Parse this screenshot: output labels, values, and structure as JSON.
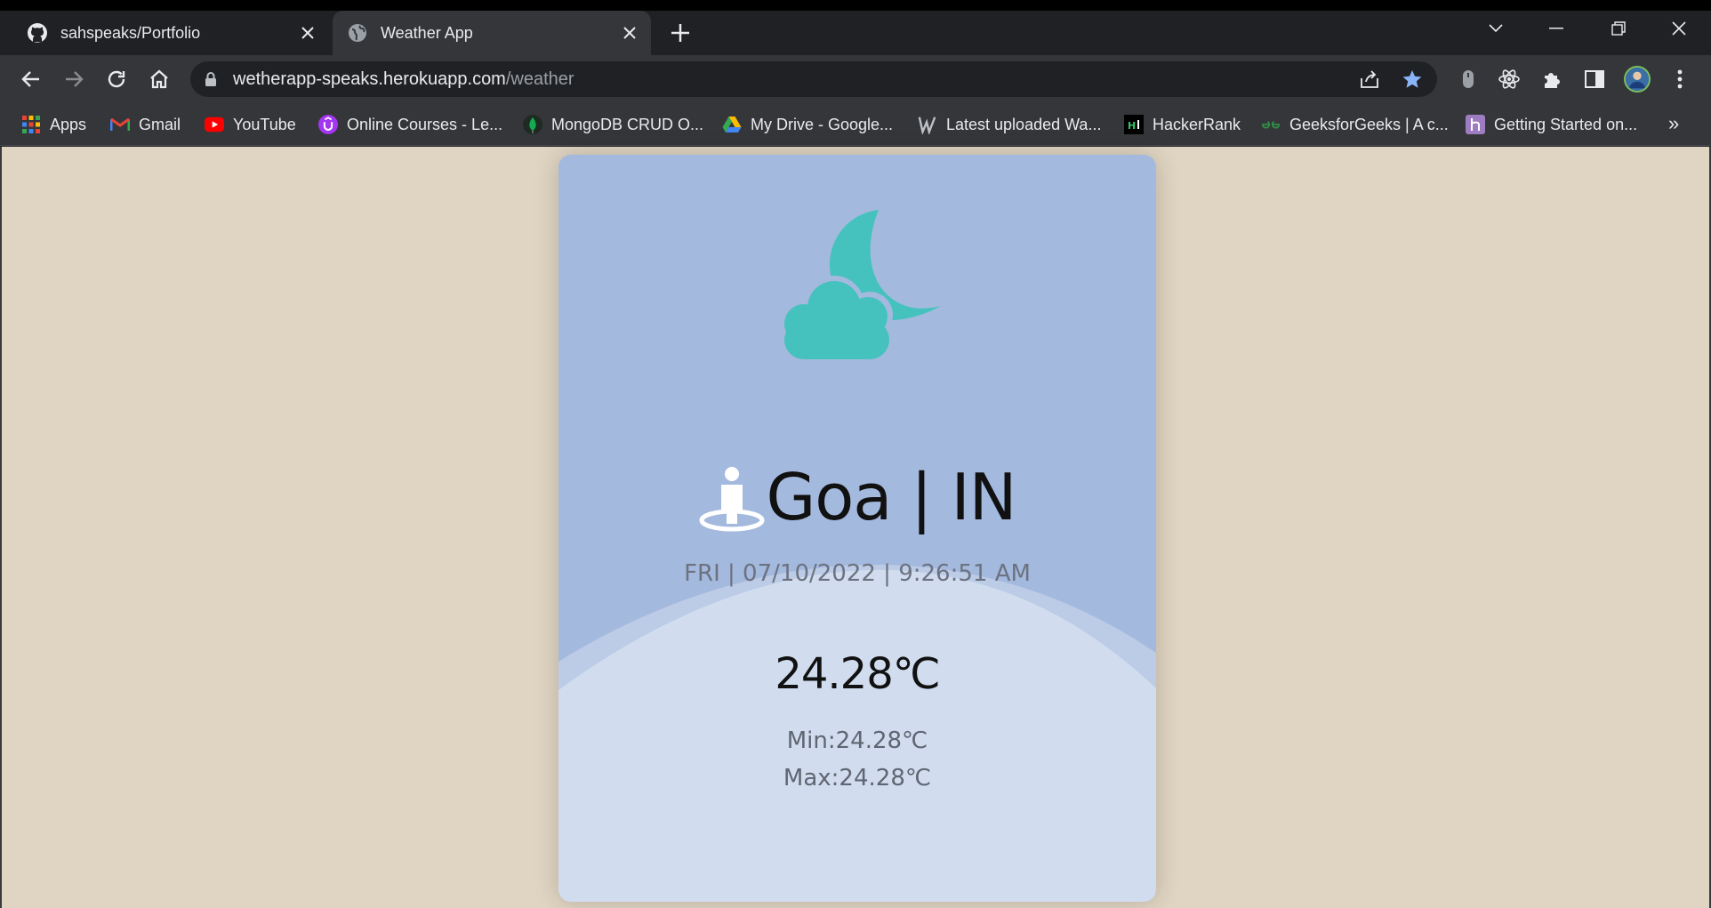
{
  "browser": {
    "tabs": [
      {
        "title": "sahspeaks/Portfolio",
        "favicon": "github-icon",
        "active": false
      },
      {
        "title": "Weather App",
        "favicon": "globe-icon",
        "active": true
      }
    ],
    "url": {
      "host": "wetherapp-speaks.herokuapp.com",
      "path": "/weather"
    },
    "bookmarks": [
      {
        "label": "Apps",
        "icon": "apps-grid-icon"
      },
      {
        "label": "Gmail",
        "icon": "gmail-icon"
      },
      {
        "label": "YouTube",
        "icon": "youtube-icon"
      },
      {
        "label": "Online Courses - Le...",
        "icon": "udemy-icon"
      },
      {
        "label": "MongoDB CRUD O...",
        "icon": "mongodb-icon"
      },
      {
        "label": "My Drive - Google...",
        "icon": "google-drive-icon"
      },
      {
        "label": "Latest uploaded Wa...",
        "icon": "w-logo-icon"
      },
      {
        "label": "HackerRank",
        "icon": "hackerrank-icon"
      },
      {
        "label": "GeeksforGeeks | A c...",
        "icon": "geeksforgeeks-icon"
      },
      {
        "label": "Getting Started on...",
        "icon": "heroku-icon"
      }
    ],
    "bookmarks_more": "»",
    "colors": {
      "tabbar": "#202124",
      "toolbar": "#35363a",
      "accent": "#8ab4f8"
    }
  },
  "weather": {
    "icon": "cloud-moon-icon",
    "location": "Goa | IN",
    "datetime": "FRI | 07/10/2022 | 9:26:51 AM",
    "temperature": "24.28℃",
    "min": "Min:24.28℃",
    "max": "Max:24.28℃",
    "colors": {
      "page_bg": "#e0d4c2",
      "card_bg": "#a4b9de",
      "wave": "#d1ddef",
      "icon": "#45c2bd"
    }
  }
}
